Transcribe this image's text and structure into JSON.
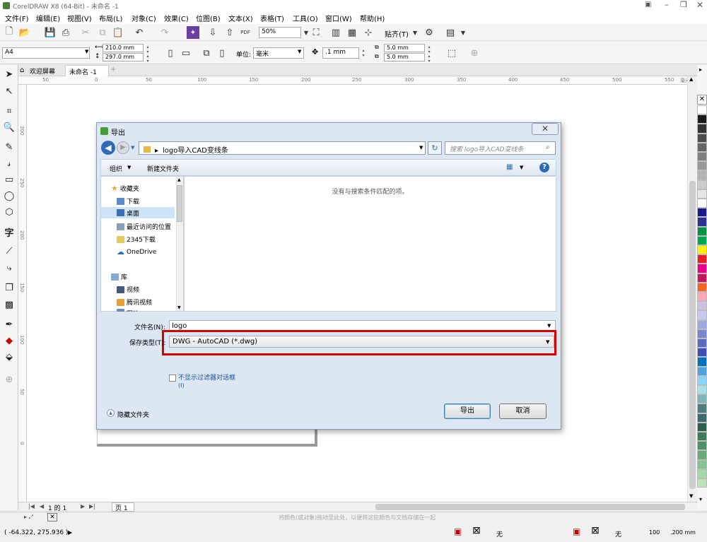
{
  "app": {
    "title": "CorelDRAW X8 (64-Bit) - 未命名 -1"
  },
  "menu": [
    "文件(F)",
    "编辑(E)",
    "视图(V)",
    "布局(L)",
    "对象(C)",
    "效果(C)",
    "位图(B)",
    "文本(X)",
    "表格(T)",
    "工具(O)",
    "窗口(W)",
    "帮助(H)"
  ],
  "toolbar1": {
    "zoom": "50%",
    "snap_label": "贴齐(T)"
  },
  "toolbar2": {
    "page_size": "A4",
    "width": "210.0 mm",
    "height": "297.0 mm",
    "units_label": "单位:",
    "units": "毫米",
    "nudge": ".1 mm",
    "dup_x": "5.0 mm",
    "dup_y": "5.0 mm"
  },
  "tabs": {
    "welcome": "欢迎屏幕",
    "doc": "未命名 -1"
  },
  "ruler": {
    "h_labels": [
      "50",
      "0",
      "50",
      "100",
      "150",
      "200",
      "250",
      "300",
      "350",
      "400",
      "450",
      "500",
      "550"
    ],
    "h_unit": "毫米",
    "v_labels": [
      "300",
      "250",
      "200",
      "150",
      "100",
      "50",
      "0"
    ]
  },
  "pagebar": {
    "page_of": "1 的 1",
    "page_tab": "页 1"
  },
  "status": {
    "coords": "( -64.322, 275.936 )",
    "hint": "将颜色(或对象)拖动至此处，以便将这些颜色与文档存储在一起",
    "fill_none": "无",
    "outline_none": "无",
    "outline_size": ".200 mm",
    "zoom_value": "100"
  },
  "dialog": {
    "title": "导出",
    "breadcrumb": "logo导入CAD变线条",
    "search_placeholder": "搜索 logo导入CAD变线条",
    "organize": "组织",
    "new_folder": "新建文件夹",
    "empty_message": "没有与搜索条件匹配的项。",
    "nav": {
      "favorites": "收藏夹",
      "downloads": "下载",
      "desktop": "桌面",
      "recent": "最近访问的位置",
      "dl2345": "2345下载",
      "onedrive": "OneDrive",
      "library": "库",
      "videos": "视频",
      "tencent": "腾讯视频",
      "pictures": "图片"
    },
    "filename_label": "文件名(N):",
    "filename": "logo",
    "savetype_label": "保存类型(T):",
    "savetype": "DWG - AutoCAD (*.dwg)",
    "no_filter_label": "不显示过滤器对话框",
    "no_filter_label2": "(I)",
    "hide_folders": "隐藏文件夹",
    "export_button": "导出",
    "cancel_button": "取消"
  },
  "colors": {
    "highlight": "#d40000",
    "palette": [
      "#ffffff",
      "#1a1a1a",
      "#333333",
      "#4d4d4d",
      "#666666",
      "#808080",
      "#999999",
      "#b3b3b3",
      "#cccccc",
      "#e6e6e6",
      "#ffffff",
      "#1a1a8a",
      "#2e3192",
      "#009245",
      "#00a651",
      "#fff200",
      "#ed1c24",
      "#ec008c",
      "#c2185b",
      "#f26522",
      "#f7a8b8",
      "#d0c0e0",
      "#c8c8f0",
      "#9fa8da",
      "#7986cb",
      "#5c6bc0",
      "#3f51b5",
      "#0072bc",
      "#4fa3e0",
      "#8fd3f4",
      "#a8e0e8",
      "#7fb5b5",
      "#4d7f7f",
      "#3a6b6b",
      "#2e5e4e",
      "#3d7a5a",
      "#4f9068",
      "#6aab7a",
      "#84c48f",
      "#a2d9a5",
      "#b9e4b8"
    ]
  }
}
